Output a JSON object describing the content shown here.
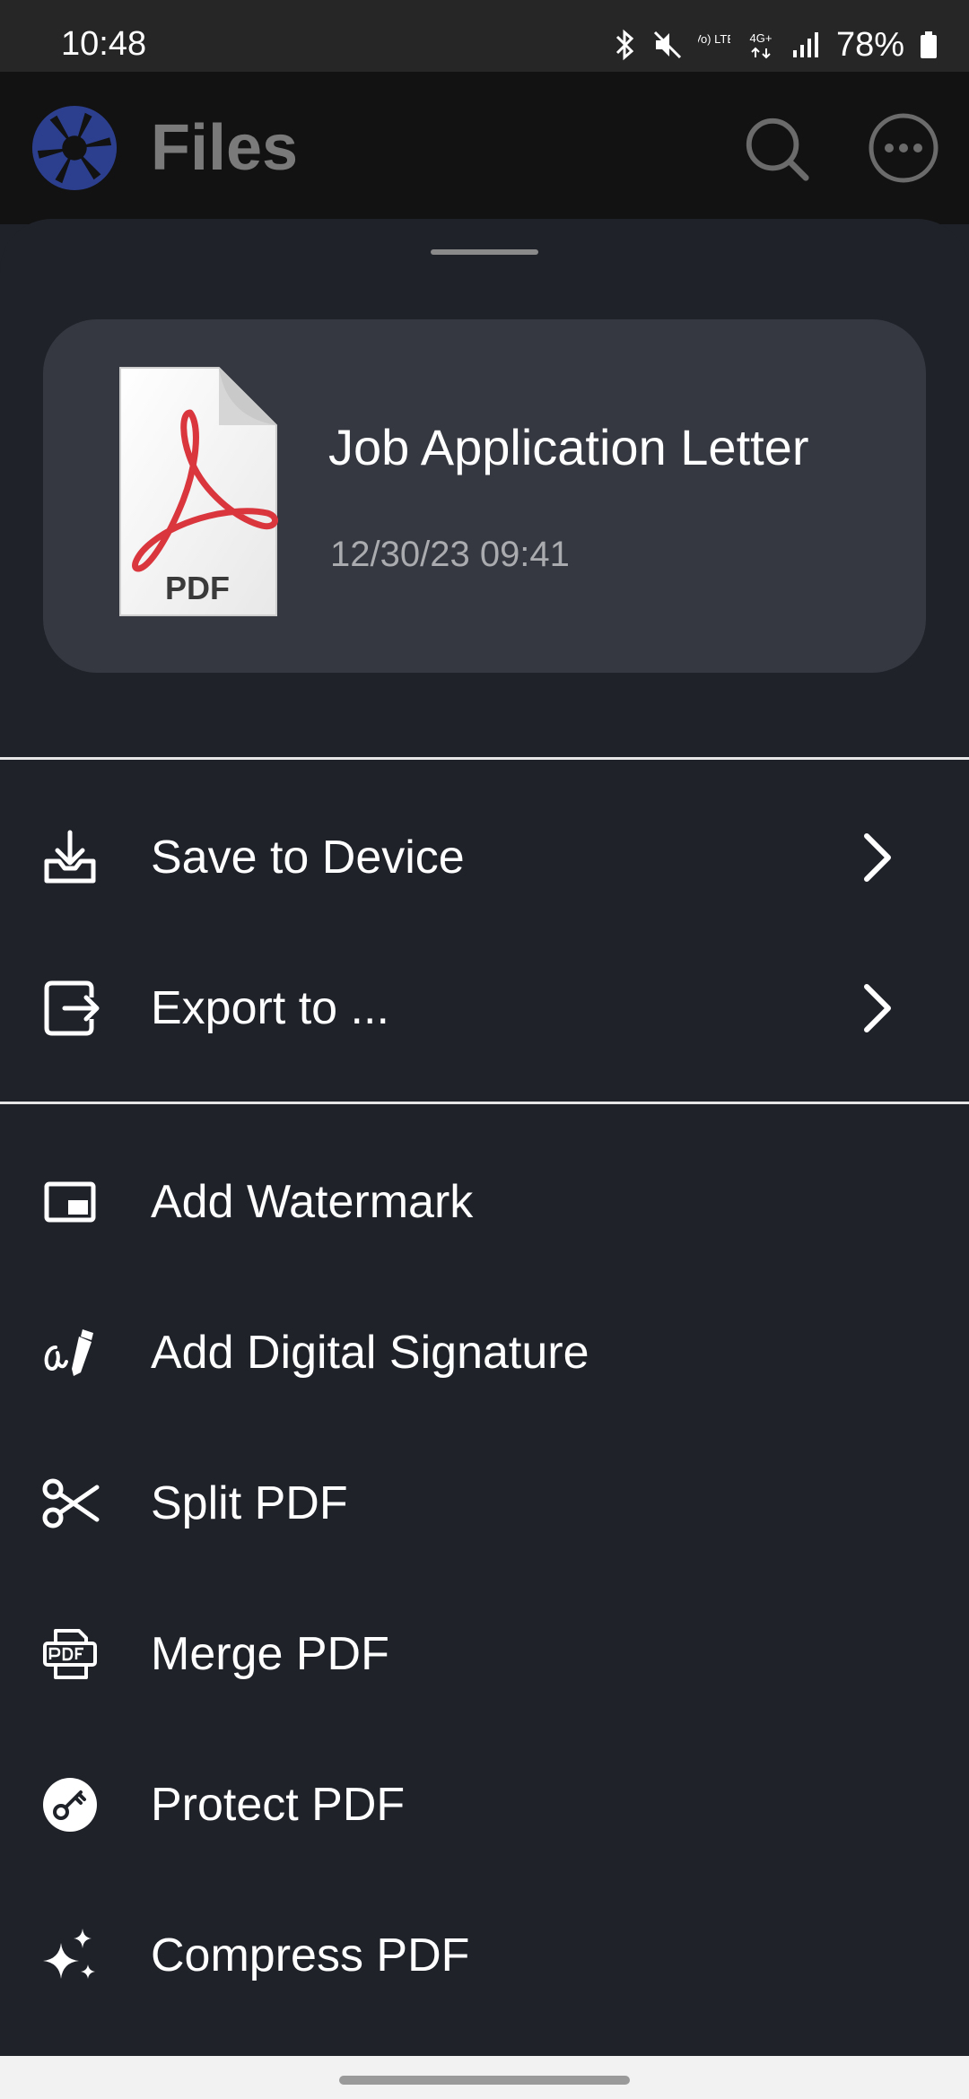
{
  "status_bar": {
    "time": "10:48",
    "network_label": "4G+",
    "volte_label": "Vo) LTE",
    "battery": "78%"
  },
  "app_bar": {
    "title": "Files",
    "logo_color": "#2c3f8f"
  },
  "file_card": {
    "file_name": "Job Application Letter",
    "modified": "12/30/23 09:41",
    "thumbnail_label": "PDF"
  },
  "menu": {
    "save_to_device": "Save to Device",
    "export_to": "Export to ...",
    "add_watermark": "Add Watermark",
    "add_digital_signature": "Add Digital Signature",
    "split_pdf": "Split PDF",
    "merge_pdf": "Merge PDF",
    "protect_pdf": "Protect PDF",
    "compress_pdf": "Compress PDF"
  },
  "icons": {
    "save": "download-icon",
    "export": "export-icon",
    "watermark": "watermark-icon",
    "signature": "signature-icon",
    "split": "scissors-icon",
    "merge": "pdf-merge-icon",
    "protect": "key-icon",
    "compress": "sparkle-icon"
  },
  "colors": {
    "sheet_background": "#1f2229",
    "card_background": "#353840",
    "pdf_red": "#d9363e"
  }
}
